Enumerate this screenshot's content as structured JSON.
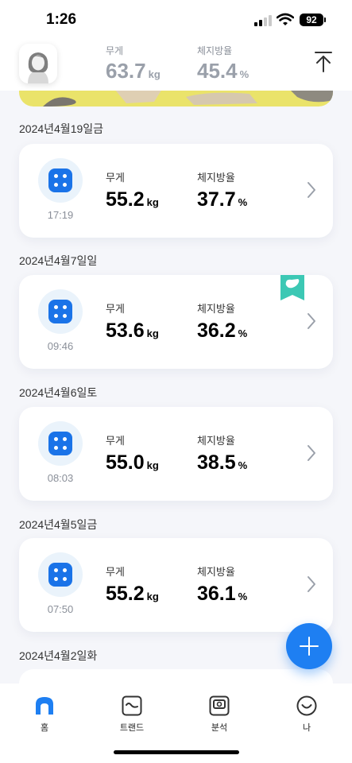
{
  "status_bar": {
    "time": "1:26",
    "battery": "92"
  },
  "header": {
    "weight": {
      "label": "무게",
      "value": "63.7",
      "unit": "kg"
    },
    "body_fat": {
      "label": "체지방율",
      "value": "45.4",
      "unit": "%"
    }
  },
  "records": [
    {
      "date": "2024년4월19일금",
      "time": "17:19",
      "weight_label": "무게",
      "weight": "55.2",
      "weight_unit": "kg",
      "fat_label": "체지방율",
      "fat": "37.7",
      "fat_unit": "%"
    },
    {
      "date": "2024년4월7일일",
      "time": "09:46",
      "weight_label": "무게",
      "weight": "53.6",
      "weight_unit": "kg",
      "fat_label": "체지방율",
      "fat": "36.2",
      "fat_unit": "%"
    },
    {
      "date": "2024년4월6일토",
      "time": "08:03",
      "weight_label": "무게",
      "weight": "55.0",
      "weight_unit": "kg",
      "fat_label": "체지방율",
      "fat": "38.5",
      "fat_unit": "%"
    },
    {
      "date": "2024년4월5일금",
      "time": "07:50",
      "weight_label": "무게",
      "weight": "55.2",
      "weight_unit": "kg",
      "fat_label": "체지방율",
      "fat": "36.1",
      "fat_unit": "%"
    },
    {
      "date": "2024년4월2일화"
    }
  ],
  "tabs": [
    {
      "label": "홈",
      "icon": "home-icon",
      "active": true
    },
    {
      "label": "트랜드",
      "icon": "trend-icon",
      "active": false
    },
    {
      "label": "분석",
      "icon": "analysis-icon",
      "active": false
    },
    {
      "label": "나",
      "icon": "profile-icon",
      "active": false
    }
  ],
  "colors": {
    "accent": "#1e7ff2",
    "device": "#1a73e8",
    "bookmark": "#3cc8b4",
    "banner": "#eae36a"
  }
}
